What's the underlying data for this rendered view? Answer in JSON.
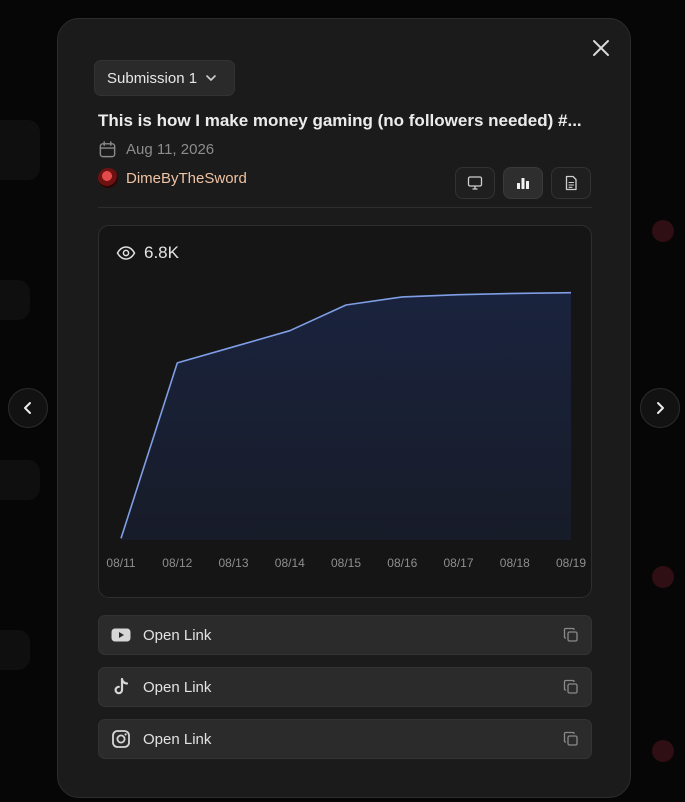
{
  "submission_select": {
    "label": "Submission 1"
  },
  "post": {
    "title": "This is how I make money gaming (no followers needed) #...",
    "date": "Aug 11, 2026",
    "author": "DimeByTheSword"
  },
  "view_toggles": [
    "monitor-icon",
    "bar-chart-icon",
    "file-text-icon"
  ],
  "active_view": "bar-chart-icon",
  "views_count": "6.8K",
  "chart_data": {
    "type": "area",
    "x": [
      "08/11",
      "08/12",
      "08/13",
      "08/14",
      "08/15",
      "08/16",
      "08/17",
      "08/18",
      "08/19"
    ],
    "series": [
      {
        "values": [
          50,
          5500,
          6000,
          6500,
          7300,
          7550,
          7620,
          7660,
          7680
        ]
      }
    ],
    "ylim": [
      0,
      8200
    ],
    "grid": false,
    "colors": {
      "line": "#7f9ee6",
      "fill": "#1a2440"
    }
  },
  "links": [
    {
      "icon": "youtube-icon",
      "label": "Open Link"
    },
    {
      "icon": "tiktok-icon",
      "label": "Open Link"
    },
    {
      "icon": "instagram-icon",
      "label": "Open Link"
    }
  ]
}
